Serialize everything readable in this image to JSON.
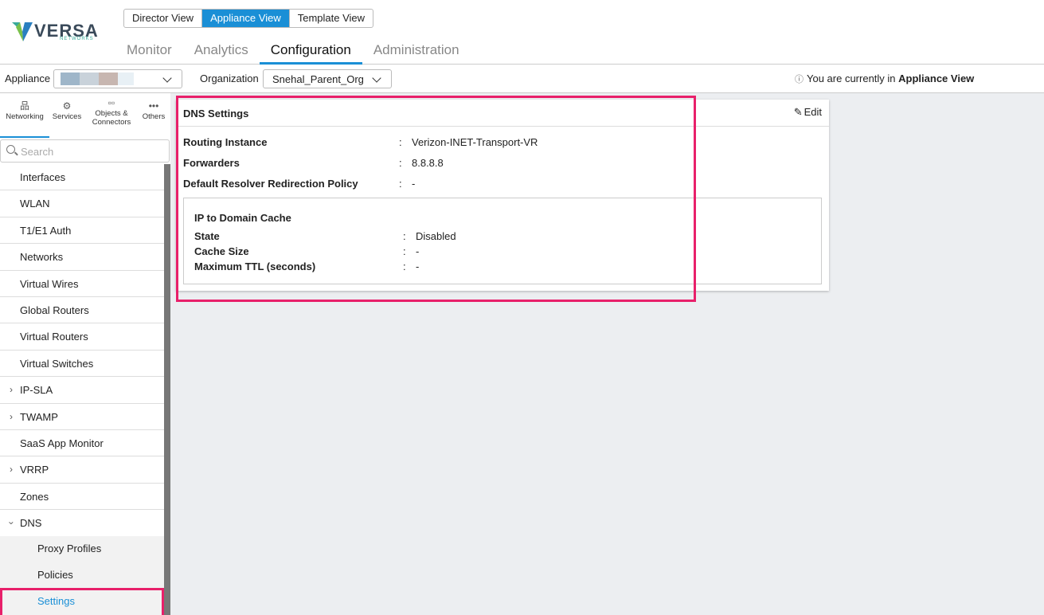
{
  "brand": {
    "name": "VERSA",
    "tagline": "NETWORKS"
  },
  "view_switch": [
    "Director View",
    "Appliance View",
    "Template View"
  ],
  "main_tabs": [
    "Monitor",
    "Analytics",
    "Configuration",
    "Administration"
  ],
  "filter": {
    "appliance_label": "Appliance",
    "organization_label": "Organization",
    "organization_value": "Snehal_Parent_Org",
    "note_prefix": "You are currently in",
    "note_view": "Appliance View"
  },
  "sidebar": {
    "icons": [
      "Networking",
      "Services",
      "Objects &\nConnectors",
      "Others"
    ],
    "search_placeholder": "Search",
    "items": [
      "Interfaces",
      "WLAN",
      "T1/E1 Auth",
      "Networks",
      "Virtual Wires",
      "Global Routers",
      "Virtual Routers",
      "Virtual Switches",
      "IP-SLA",
      "TWAMP",
      "SaaS App Monitor",
      "VRRP",
      "Zones",
      "DNS"
    ],
    "dns_children": [
      "Proxy Profiles",
      "Policies",
      "Settings"
    ]
  },
  "dns": {
    "title": "DNS Settings",
    "edit_label": "Edit",
    "rows": [
      {
        "key": "Routing Instance",
        "value": "Verizon-INET-Transport-VR"
      },
      {
        "key": "Forwarders",
        "value": "8.8.8.8"
      },
      {
        "key": "Default Resolver Redirection Policy",
        "value": "-"
      }
    ],
    "cache": {
      "title": "IP to Domain Cache",
      "rows": [
        {
          "key": "State",
          "value": "Disabled"
        },
        {
          "key": "Cache Size",
          "value": "-"
        },
        {
          "key": "Maximum TTL (seconds)",
          "value": "-"
        }
      ]
    }
  },
  "colors": {
    "accent": "#1a8fd6",
    "highlight": "#e8206a"
  }
}
